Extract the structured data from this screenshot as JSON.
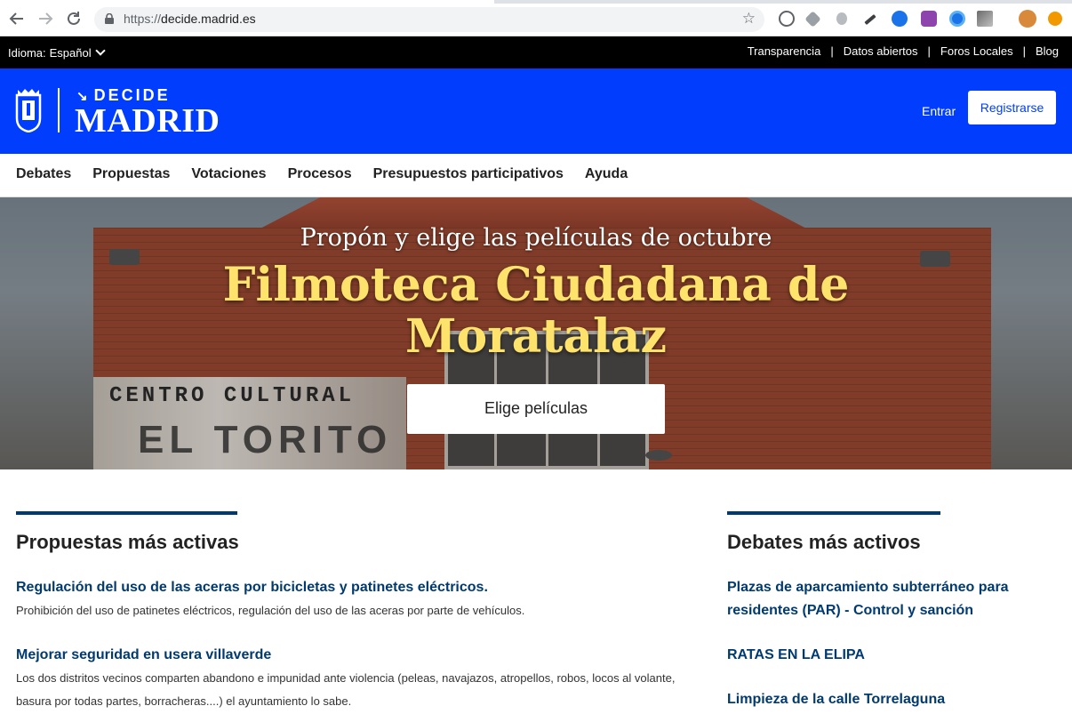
{
  "browser": {
    "url_scheme": "https://",
    "url_host": "decide.madrid.es"
  },
  "topbar": {
    "language_label": "Idioma:",
    "language_value": "Español",
    "links": [
      "Transparencia",
      "Datos abiertos",
      "Foros Locales",
      "Blog"
    ]
  },
  "header": {
    "brand_small": "DECIDE",
    "brand_big": "MADRID",
    "login_label": "Entrar",
    "register_label": "Registrarse"
  },
  "mainnav": {
    "items": [
      "Debates",
      "Propuestas",
      "Votaciones",
      "Procesos",
      "Presupuestos participativos",
      "Ayuda"
    ]
  },
  "hero": {
    "subtitle": "Propón y elige las películas de octubre",
    "title": "Filmoteca Ciudadana de Moratalaz",
    "cta_label": "Elige películas",
    "background_sign_line1": "CENTRO CULTURAL",
    "background_sign_line2": "EL TORITO"
  },
  "proposals": {
    "heading": "Propuestas más activas",
    "items": [
      {
        "title": "Regulación del uso de las aceras por bicicletas y patinetes eléctricos.",
        "description": "Prohibición del uso de patinetes eléctricos, regulación del uso de las aceras por parte de vehículos."
      },
      {
        "title": "Mejorar seguridad en usera villaverde",
        "description": "Los dos distritos vecinos comparten abandono e impunidad ante violencia (peleas, navajazos, atropellos, robos, locos al volante, basura por todas partes, borracheras....) el ayuntamiento lo sabe."
      }
    ]
  },
  "debates": {
    "heading": "Debates más activos",
    "items": [
      "Plazas de aparcamiento subterráneo para residentes (PAR) - Control y sanción",
      "RATAS EN LA ELIPA",
      "Limpieza de la calle Torrelaguna"
    ]
  },
  "colors": {
    "brand_blue": "#003dfd",
    "link_navy": "#003a70",
    "hero_title_yellow": "#fde26b"
  }
}
